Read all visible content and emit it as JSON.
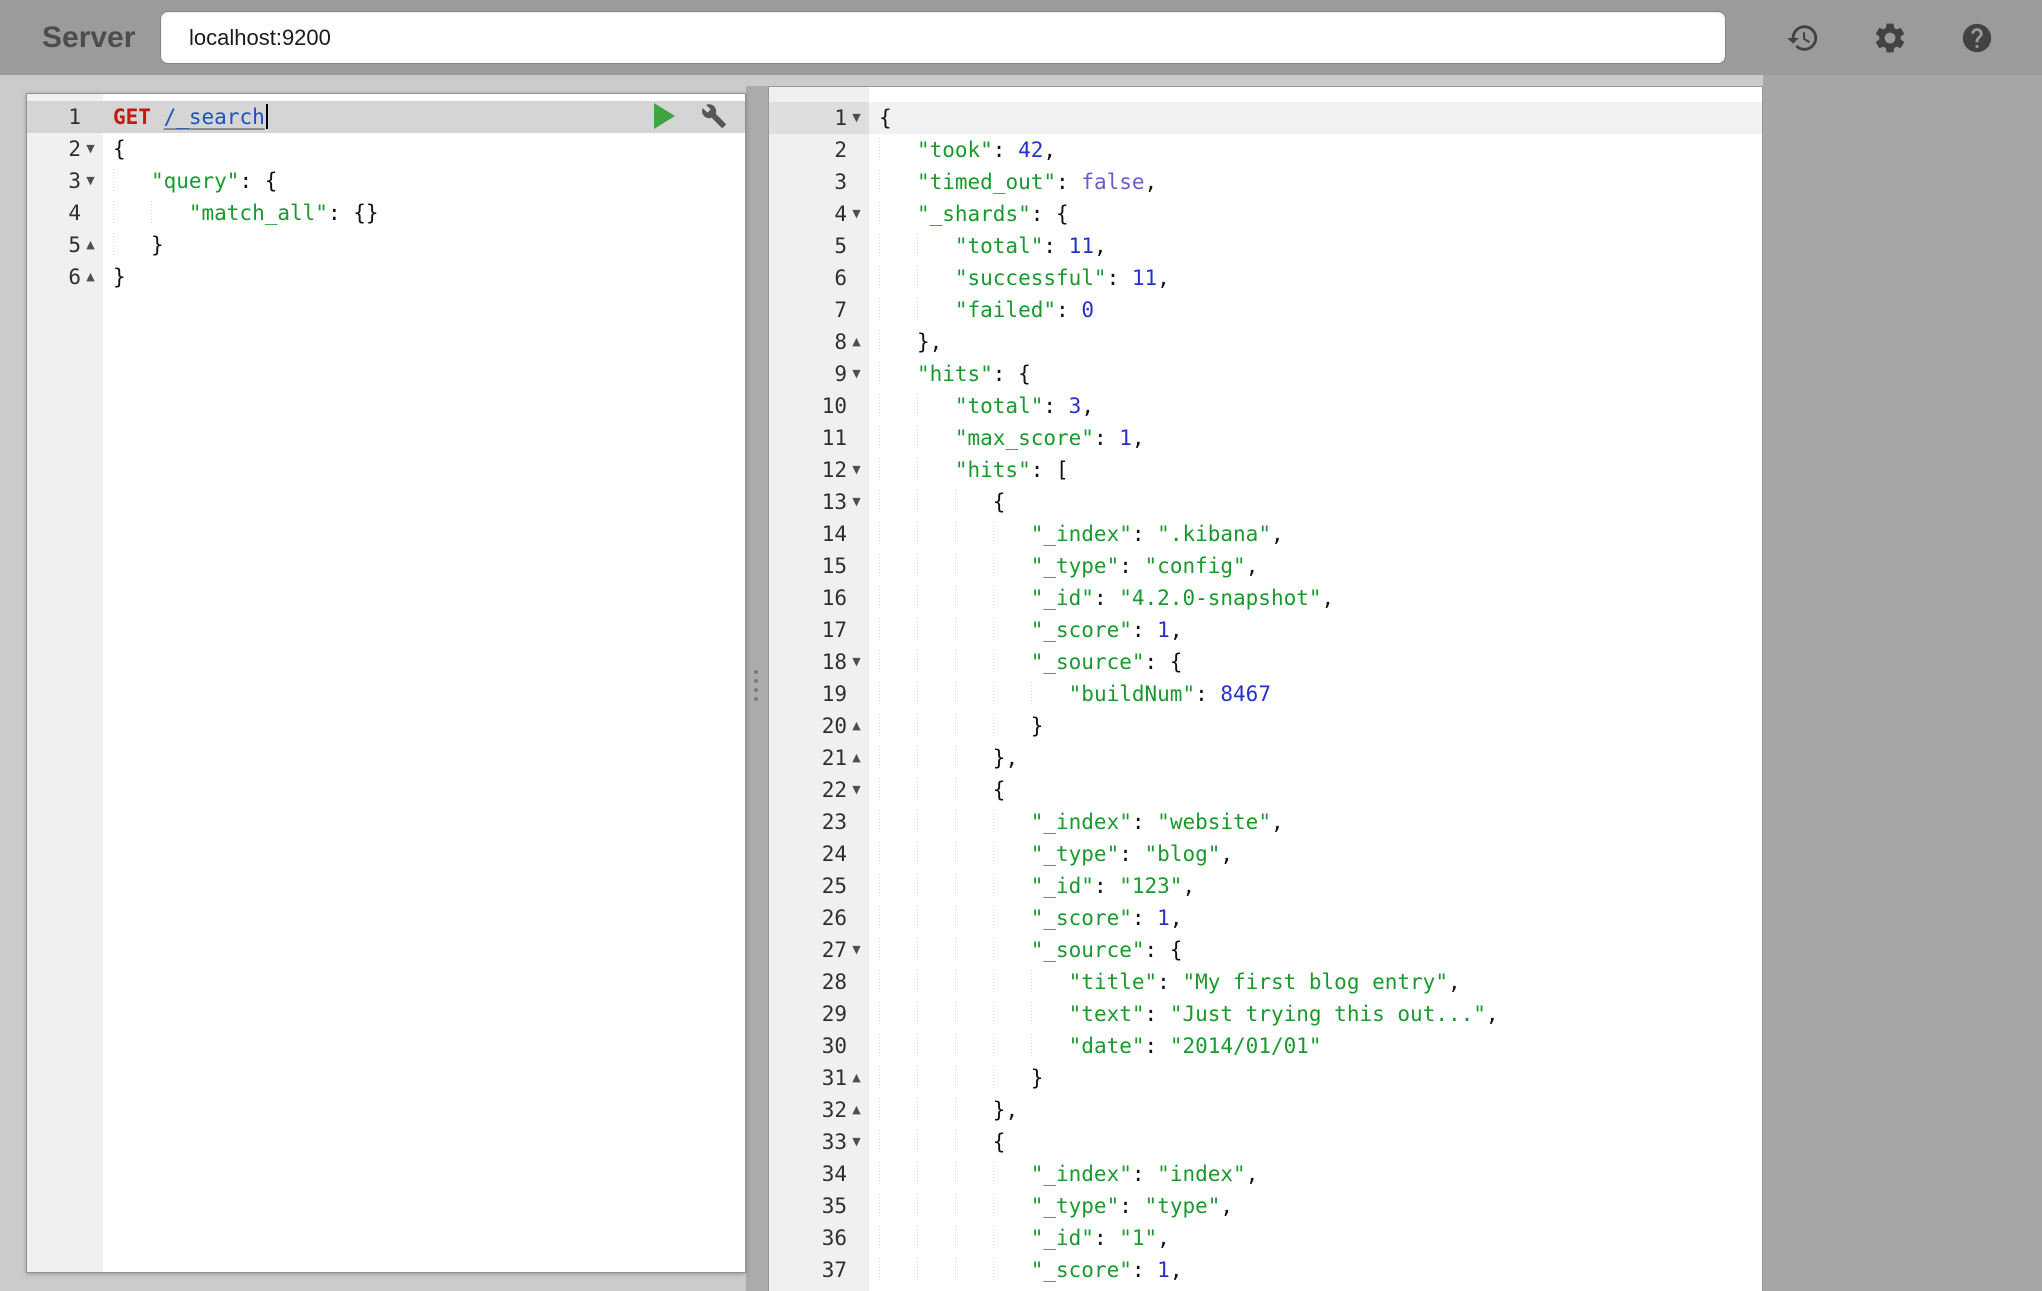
{
  "header": {
    "server_label": "Server",
    "server_value": "localhost:9200",
    "icons": [
      "history-icon",
      "settings-icon",
      "help-icon"
    ]
  },
  "colors": {
    "method": "#c41a16",
    "url": "#1b53c4",
    "string": "#189a2c",
    "number": "#2233cc",
    "boolean": "#6b5bd2",
    "run": "#3fa63f"
  },
  "editor": {
    "active_line": 1,
    "lines": [
      {
        "n": 1,
        "f": "",
        "cursor": true,
        "t": [
          {
            "s": "GET",
            "c": "method"
          },
          {
            "s": " ",
            "c": "plain"
          },
          {
            "s": "/_search",
            "c": "url"
          }
        ]
      },
      {
        "n": 2,
        "f": "open",
        "t": [
          {
            "s": "{",
            "c": "plain"
          }
        ]
      },
      {
        "n": 3,
        "f": "open",
        "t": [
          {
            "s": "   ",
            "c": "indent"
          },
          {
            "s": "\"query\"",
            "c": "key"
          },
          {
            "s": ": {",
            "c": "plain"
          }
        ]
      },
      {
        "n": 4,
        "f": "",
        "t": [
          {
            "s": "      ",
            "c": "indent"
          },
          {
            "s": "\"match_all\"",
            "c": "key"
          },
          {
            "s": ": {}",
            "c": "plain"
          }
        ]
      },
      {
        "n": 5,
        "f": "close",
        "t": [
          {
            "s": "   ",
            "c": "indent"
          },
          {
            "s": "}",
            "c": "plain"
          }
        ]
      },
      {
        "n": 6,
        "f": "close",
        "t": [
          {
            "s": "}",
            "c": "plain"
          }
        ]
      }
    ]
  },
  "output": {
    "active_line": 1,
    "lines": [
      {
        "n": 1,
        "f": "open",
        "t": [
          {
            "s": "{",
            "c": "plain"
          }
        ]
      },
      {
        "n": 2,
        "f": "",
        "t": [
          {
            "s": "   ",
            "c": "indent"
          },
          {
            "s": "\"took\"",
            "c": "key"
          },
          {
            "s": ": ",
            "c": "plain"
          },
          {
            "s": "42",
            "c": "num"
          },
          {
            "s": ",",
            "c": "plain"
          }
        ]
      },
      {
        "n": 3,
        "f": "",
        "t": [
          {
            "s": "   ",
            "c": "indent"
          },
          {
            "s": "\"timed_out\"",
            "c": "key"
          },
          {
            "s": ": ",
            "c": "plain"
          },
          {
            "s": "false",
            "c": "bool"
          },
          {
            "s": ",",
            "c": "plain"
          }
        ]
      },
      {
        "n": 4,
        "f": "open",
        "t": [
          {
            "s": "   ",
            "c": "indent"
          },
          {
            "s": "\"_shards\"",
            "c": "key"
          },
          {
            "s": ": {",
            "c": "plain"
          }
        ]
      },
      {
        "n": 5,
        "f": "",
        "t": [
          {
            "s": "      ",
            "c": "indent"
          },
          {
            "s": "\"total\"",
            "c": "key"
          },
          {
            "s": ": ",
            "c": "plain"
          },
          {
            "s": "11",
            "c": "num"
          },
          {
            "s": ",",
            "c": "plain"
          }
        ]
      },
      {
        "n": 6,
        "f": "",
        "t": [
          {
            "s": "      ",
            "c": "indent"
          },
          {
            "s": "\"successful\"",
            "c": "key"
          },
          {
            "s": ": ",
            "c": "plain"
          },
          {
            "s": "11",
            "c": "num"
          },
          {
            "s": ",",
            "c": "plain"
          }
        ]
      },
      {
        "n": 7,
        "f": "",
        "t": [
          {
            "s": "      ",
            "c": "indent"
          },
          {
            "s": "\"failed\"",
            "c": "key"
          },
          {
            "s": ": ",
            "c": "plain"
          },
          {
            "s": "0",
            "c": "num"
          }
        ]
      },
      {
        "n": 8,
        "f": "close",
        "t": [
          {
            "s": "   ",
            "c": "indent"
          },
          {
            "s": "},",
            "c": "plain"
          }
        ]
      },
      {
        "n": 9,
        "f": "open",
        "t": [
          {
            "s": "   ",
            "c": "indent"
          },
          {
            "s": "\"hits\"",
            "c": "key"
          },
          {
            "s": ": {",
            "c": "plain"
          }
        ]
      },
      {
        "n": 10,
        "f": "",
        "t": [
          {
            "s": "      ",
            "c": "indent"
          },
          {
            "s": "\"total\"",
            "c": "key"
          },
          {
            "s": ": ",
            "c": "plain"
          },
          {
            "s": "3",
            "c": "num"
          },
          {
            "s": ",",
            "c": "plain"
          }
        ]
      },
      {
        "n": 11,
        "f": "",
        "t": [
          {
            "s": "      ",
            "c": "indent"
          },
          {
            "s": "\"max_score\"",
            "c": "key"
          },
          {
            "s": ": ",
            "c": "plain"
          },
          {
            "s": "1",
            "c": "num"
          },
          {
            "s": ",",
            "c": "plain"
          }
        ]
      },
      {
        "n": 12,
        "f": "open",
        "t": [
          {
            "s": "      ",
            "c": "indent"
          },
          {
            "s": "\"hits\"",
            "c": "key"
          },
          {
            "s": ": [",
            "c": "plain"
          }
        ]
      },
      {
        "n": 13,
        "f": "open",
        "t": [
          {
            "s": "         ",
            "c": "indent"
          },
          {
            "s": "{",
            "c": "plain"
          }
        ]
      },
      {
        "n": 14,
        "f": "",
        "t": [
          {
            "s": "            ",
            "c": "indent"
          },
          {
            "s": "\"_index\"",
            "c": "key"
          },
          {
            "s": ": ",
            "c": "plain"
          },
          {
            "s": "\".kibana\"",
            "c": "str"
          },
          {
            "s": ",",
            "c": "plain"
          }
        ]
      },
      {
        "n": 15,
        "f": "",
        "t": [
          {
            "s": "            ",
            "c": "indent"
          },
          {
            "s": "\"_type\"",
            "c": "key"
          },
          {
            "s": ": ",
            "c": "plain"
          },
          {
            "s": "\"config\"",
            "c": "str"
          },
          {
            "s": ",",
            "c": "plain"
          }
        ]
      },
      {
        "n": 16,
        "f": "",
        "t": [
          {
            "s": "            ",
            "c": "indent"
          },
          {
            "s": "\"_id\"",
            "c": "key"
          },
          {
            "s": ": ",
            "c": "plain"
          },
          {
            "s": "\"4.2.0-snapshot\"",
            "c": "str"
          },
          {
            "s": ",",
            "c": "plain"
          }
        ]
      },
      {
        "n": 17,
        "f": "",
        "t": [
          {
            "s": "            ",
            "c": "indent"
          },
          {
            "s": "\"_score\"",
            "c": "key"
          },
          {
            "s": ": ",
            "c": "plain"
          },
          {
            "s": "1",
            "c": "num"
          },
          {
            "s": ",",
            "c": "plain"
          }
        ]
      },
      {
        "n": 18,
        "f": "open",
        "t": [
          {
            "s": "            ",
            "c": "indent"
          },
          {
            "s": "\"_source\"",
            "c": "key"
          },
          {
            "s": ": {",
            "c": "plain"
          }
        ]
      },
      {
        "n": 19,
        "f": "",
        "t": [
          {
            "s": "               ",
            "c": "indent"
          },
          {
            "s": "\"buildNum\"",
            "c": "key"
          },
          {
            "s": ": ",
            "c": "plain"
          },
          {
            "s": "8467",
            "c": "num"
          }
        ]
      },
      {
        "n": 20,
        "f": "close",
        "t": [
          {
            "s": "            ",
            "c": "indent"
          },
          {
            "s": "}",
            "c": "plain"
          }
        ]
      },
      {
        "n": 21,
        "f": "close",
        "t": [
          {
            "s": "         ",
            "c": "indent"
          },
          {
            "s": "},",
            "c": "plain"
          }
        ]
      },
      {
        "n": 22,
        "f": "open",
        "t": [
          {
            "s": "         ",
            "c": "indent"
          },
          {
            "s": "{",
            "c": "plain"
          }
        ]
      },
      {
        "n": 23,
        "f": "",
        "t": [
          {
            "s": "            ",
            "c": "indent"
          },
          {
            "s": "\"_index\"",
            "c": "key"
          },
          {
            "s": ": ",
            "c": "plain"
          },
          {
            "s": "\"website\"",
            "c": "str"
          },
          {
            "s": ",",
            "c": "plain"
          }
        ]
      },
      {
        "n": 24,
        "f": "",
        "t": [
          {
            "s": "            ",
            "c": "indent"
          },
          {
            "s": "\"_type\"",
            "c": "key"
          },
          {
            "s": ": ",
            "c": "plain"
          },
          {
            "s": "\"blog\"",
            "c": "str"
          },
          {
            "s": ",",
            "c": "plain"
          }
        ]
      },
      {
        "n": 25,
        "f": "",
        "t": [
          {
            "s": "            ",
            "c": "indent"
          },
          {
            "s": "\"_id\"",
            "c": "key"
          },
          {
            "s": ": ",
            "c": "plain"
          },
          {
            "s": "\"123\"",
            "c": "str"
          },
          {
            "s": ",",
            "c": "plain"
          }
        ]
      },
      {
        "n": 26,
        "f": "",
        "t": [
          {
            "s": "            ",
            "c": "indent"
          },
          {
            "s": "\"_score\"",
            "c": "key"
          },
          {
            "s": ": ",
            "c": "plain"
          },
          {
            "s": "1",
            "c": "num"
          },
          {
            "s": ",",
            "c": "plain"
          }
        ]
      },
      {
        "n": 27,
        "f": "open",
        "t": [
          {
            "s": "            ",
            "c": "indent"
          },
          {
            "s": "\"_source\"",
            "c": "key"
          },
          {
            "s": ": {",
            "c": "plain"
          }
        ]
      },
      {
        "n": 28,
        "f": "",
        "t": [
          {
            "s": "               ",
            "c": "indent"
          },
          {
            "s": "\"title\"",
            "c": "key"
          },
          {
            "s": ": ",
            "c": "plain"
          },
          {
            "s": "\"My first blog entry\"",
            "c": "str"
          },
          {
            "s": ",",
            "c": "plain"
          }
        ]
      },
      {
        "n": 29,
        "f": "",
        "t": [
          {
            "s": "               ",
            "c": "indent"
          },
          {
            "s": "\"text\"",
            "c": "key"
          },
          {
            "s": ": ",
            "c": "plain"
          },
          {
            "s": "\"Just trying this out...\"",
            "c": "str"
          },
          {
            "s": ",",
            "c": "plain"
          }
        ]
      },
      {
        "n": 30,
        "f": "",
        "t": [
          {
            "s": "               ",
            "c": "indent"
          },
          {
            "s": "\"date\"",
            "c": "key"
          },
          {
            "s": ": ",
            "c": "plain"
          },
          {
            "s": "\"2014/01/01\"",
            "c": "str"
          }
        ]
      },
      {
        "n": 31,
        "f": "close",
        "t": [
          {
            "s": "            ",
            "c": "indent"
          },
          {
            "s": "}",
            "c": "plain"
          }
        ]
      },
      {
        "n": 32,
        "f": "close",
        "t": [
          {
            "s": "         ",
            "c": "indent"
          },
          {
            "s": "},",
            "c": "plain"
          }
        ]
      },
      {
        "n": 33,
        "f": "open",
        "t": [
          {
            "s": "         ",
            "c": "indent"
          },
          {
            "s": "{",
            "c": "plain"
          }
        ]
      },
      {
        "n": 34,
        "f": "",
        "t": [
          {
            "s": "            ",
            "c": "indent"
          },
          {
            "s": "\"_index\"",
            "c": "key"
          },
          {
            "s": ": ",
            "c": "plain"
          },
          {
            "s": "\"index\"",
            "c": "str"
          },
          {
            "s": ",",
            "c": "plain"
          }
        ]
      },
      {
        "n": 35,
        "f": "",
        "t": [
          {
            "s": "            ",
            "c": "indent"
          },
          {
            "s": "\"_type\"",
            "c": "key"
          },
          {
            "s": ": ",
            "c": "plain"
          },
          {
            "s": "\"type\"",
            "c": "str"
          },
          {
            "s": ",",
            "c": "plain"
          }
        ]
      },
      {
        "n": 36,
        "f": "",
        "t": [
          {
            "s": "            ",
            "c": "indent"
          },
          {
            "s": "\"_id\"",
            "c": "key"
          },
          {
            "s": ": ",
            "c": "plain"
          },
          {
            "s": "\"1\"",
            "c": "str"
          },
          {
            "s": ",",
            "c": "plain"
          }
        ]
      },
      {
        "n": 37,
        "f": "",
        "t": [
          {
            "s": "            ",
            "c": "indent"
          },
          {
            "s": "\"_score\"",
            "c": "key"
          },
          {
            "s": ": ",
            "c": "plain"
          },
          {
            "s": "1",
            "c": "num"
          },
          {
            "s": ",",
            "c": "plain"
          }
        ]
      }
    ]
  }
}
